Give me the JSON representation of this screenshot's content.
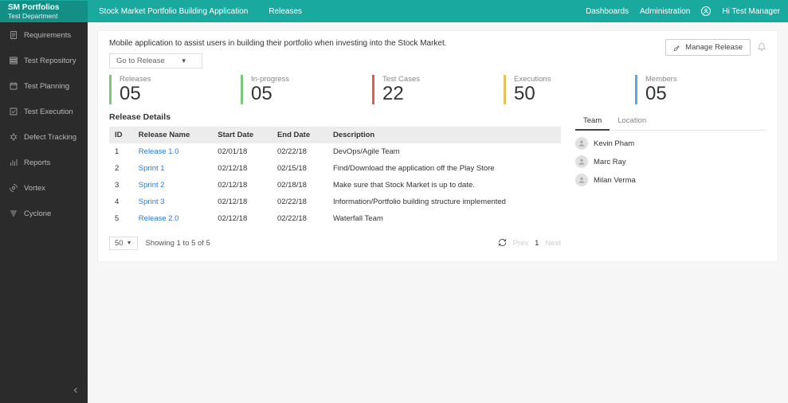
{
  "header": {
    "portfolio_title": "SM Portfolios",
    "portfolio_sub": "Test Department",
    "app_name": "Stock Market Portfolio Building Application",
    "active_tab": "Releases",
    "links": {
      "dashboards": "Dashboards",
      "administration": "Administration"
    },
    "user_greeting": "Hi  Test Manager"
  },
  "sidebar": {
    "items": [
      {
        "label": "Requirements",
        "icon": "requirements-icon"
      },
      {
        "label": "Test Repository",
        "icon": "repository-icon"
      },
      {
        "label": "Test Planning",
        "icon": "planning-icon"
      },
      {
        "label": "Test Execution",
        "icon": "execution-icon"
      },
      {
        "label": "Defect Tracking",
        "icon": "defect-icon"
      },
      {
        "label": "Reports",
        "icon": "reports-icon"
      },
      {
        "label": "Vortex",
        "icon": "vortex-icon"
      },
      {
        "label": "Cyclone",
        "icon": "cyclone-icon"
      }
    ]
  },
  "main": {
    "description": "Mobile application to assist users in building their portfolio when investing into the Stock Market.",
    "goto_label": "Go to Release",
    "manage_button": "Manage Release"
  },
  "stats": [
    {
      "label": "Releases",
      "value": "05",
      "color": "green"
    },
    {
      "label": "In-progress",
      "value": "05",
      "color": "green"
    },
    {
      "label": "Test Cases",
      "value": "22",
      "color": "red"
    },
    {
      "label": "Executions",
      "value": "50",
      "color": "yellow"
    },
    {
      "label": "Members",
      "value": "05",
      "color": "blue"
    }
  ],
  "releases": {
    "title": "Release Details",
    "columns": {
      "id": "ID",
      "name": "Release Name",
      "start": "Start Date",
      "end": "End Date",
      "desc": "Description"
    },
    "rows": [
      {
        "id": "1",
        "name": "Release 1.0",
        "start": "02/01/18",
        "end": "02/22/18",
        "desc": "DevOps/Agile Team"
      },
      {
        "id": "2",
        "name": "Sprint 1",
        "start": "02/12/18",
        "end": "02/15/18",
        "desc": "Find/Download the application off the Play Store"
      },
      {
        "id": "3",
        "name": "Sprint 2",
        "start": "02/12/18",
        "end": "02/18/18",
        "desc": "Make sure that Stock Market is up to date."
      },
      {
        "id": "4",
        "name": "Sprint 3",
        "start": "02/12/18",
        "end": "02/22/18",
        "desc": "Information/Portfolio building structure implemented"
      },
      {
        "id": "5",
        "name": "Release 2.0",
        "start": "02/12/18",
        "end": "02/22/18",
        "desc": "Waterfall Team"
      }
    ]
  },
  "pager": {
    "page_size": "50",
    "showing": "Showing 1 to 5 of 5",
    "prev": "Prev",
    "current": "1",
    "next": "Next"
  },
  "right_panel": {
    "tabs": {
      "team": "Team",
      "location": "Location"
    },
    "members": [
      {
        "name": "Kevin Pham"
      },
      {
        "name": "Marc Ray"
      },
      {
        "name": "Milan Verma"
      }
    ]
  }
}
